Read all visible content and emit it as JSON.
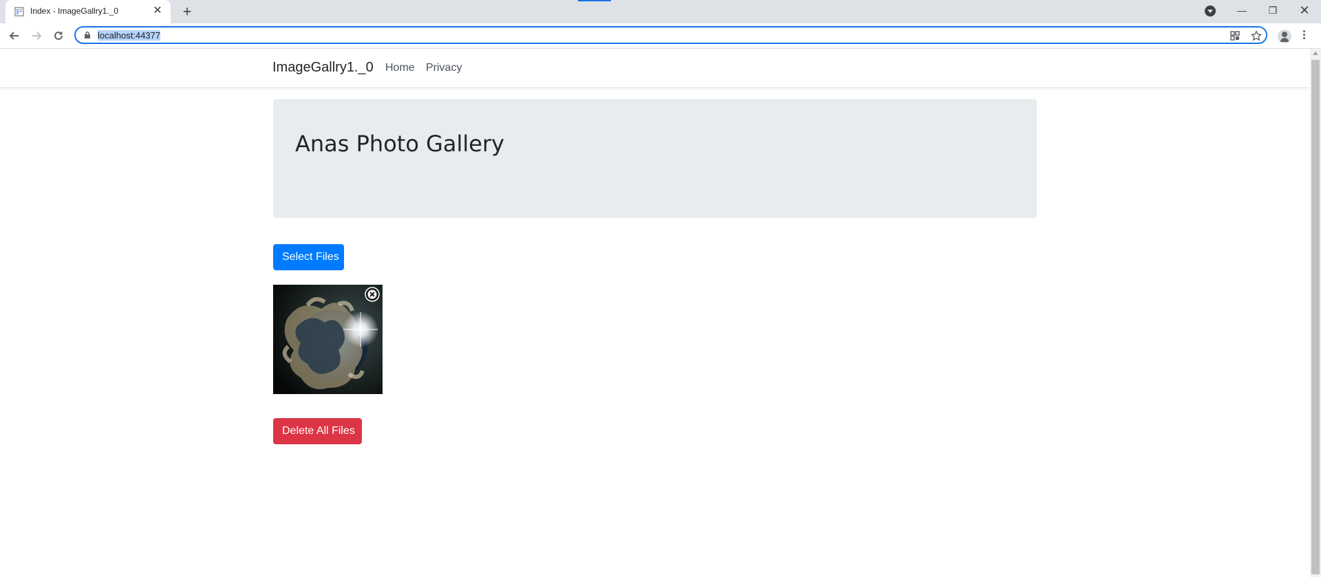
{
  "browser": {
    "tab_title": "Index - ImageGallry1._0",
    "url": "localhost:44377"
  },
  "site": {
    "brand": "ImageGallry1._0",
    "nav": [
      {
        "label": "Home"
      },
      {
        "label": "Privacy"
      }
    ]
  },
  "jumbotron": {
    "title": "Anas Photo Gallery"
  },
  "actions": {
    "select_label": "Select Files",
    "delete_all_label": "Delete All Files"
  },
  "colors": {
    "primary": "#007bff",
    "danger": "#dc3545",
    "jumbotron_bg": "#e9ecef"
  }
}
